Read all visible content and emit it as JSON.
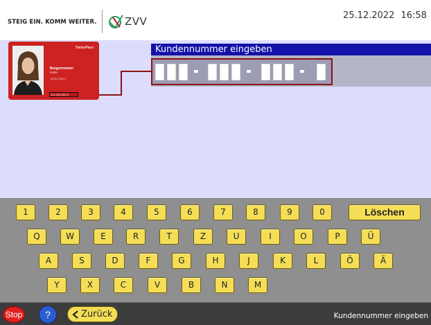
{
  "header": {
    "slogan": "STEIG EIN. KOMM WEITER.",
    "logo_text": "ZVV",
    "date": "25.12.2022",
    "time": "16:58"
  },
  "card": {
    "brand": "SwissPass",
    "last_name": "Burgermeister",
    "first_name": "Katrin",
    "dob": "18.06.1969  F",
    "number": "010-836-365-4"
  },
  "panel": {
    "title": "Kundennummer eingeben"
  },
  "keyboard": {
    "row1": [
      "1",
      "2",
      "3",
      "4",
      "5",
      "6",
      "7",
      "8",
      "9",
      "0"
    ],
    "delete_label": "Löschen",
    "row2": [
      "Q",
      "W",
      "E",
      "R",
      "T",
      "Z",
      "U",
      "I",
      "O",
      "P",
      "Ü"
    ],
    "row3": [
      "A",
      "S",
      "D",
      "F",
      "G",
      "H",
      "J",
      "K",
      "L",
      "Ö",
      "Ä"
    ],
    "row4": [
      "Y",
      "X",
      "C",
      "V",
      "B",
      "N",
      "M"
    ]
  },
  "footer": {
    "stop_label": "Stop",
    "help_label": "?",
    "back_label": "Zurück",
    "status": "Kundennummer eingeben"
  },
  "colors": {
    "title_bar": "#1212a8",
    "key": "#f5de56",
    "main_bg": "#dcdcfc",
    "card": "#cc2222"
  }
}
